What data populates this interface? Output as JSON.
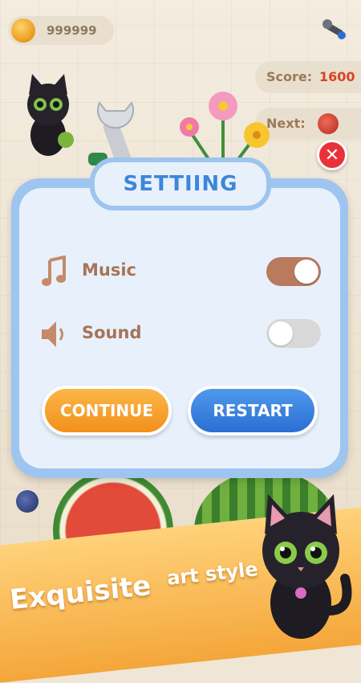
{
  "hud": {
    "coins": "999999",
    "score_label": "Score:",
    "score_value": "1600",
    "next_label": "Next:"
  },
  "dialog": {
    "title": "SETTIING",
    "music_label": "Music",
    "music_on": true,
    "sound_label": "Sound",
    "sound_on": false,
    "continue_label": "CONTINUE",
    "restart_label": "RESTART"
  },
  "banner": {
    "tagline_big": "Exquisite",
    "tagline_small": "art style"
  },
  "icons": {
    "close": "close-icon",
    "music": "music-note-icon",
    "sound": "speaker-icon",
    "tools": "wrench-icon",
    "coin": "coin-icon"
  },
  "colors": {
    "accent_blue": "#3d86dc",
    "continue": "#f2901a",
    "restart": "#2a6fd2",
    "toggle_on": "#b97a5d",
    "score_value": "#d64525"
  }
}
